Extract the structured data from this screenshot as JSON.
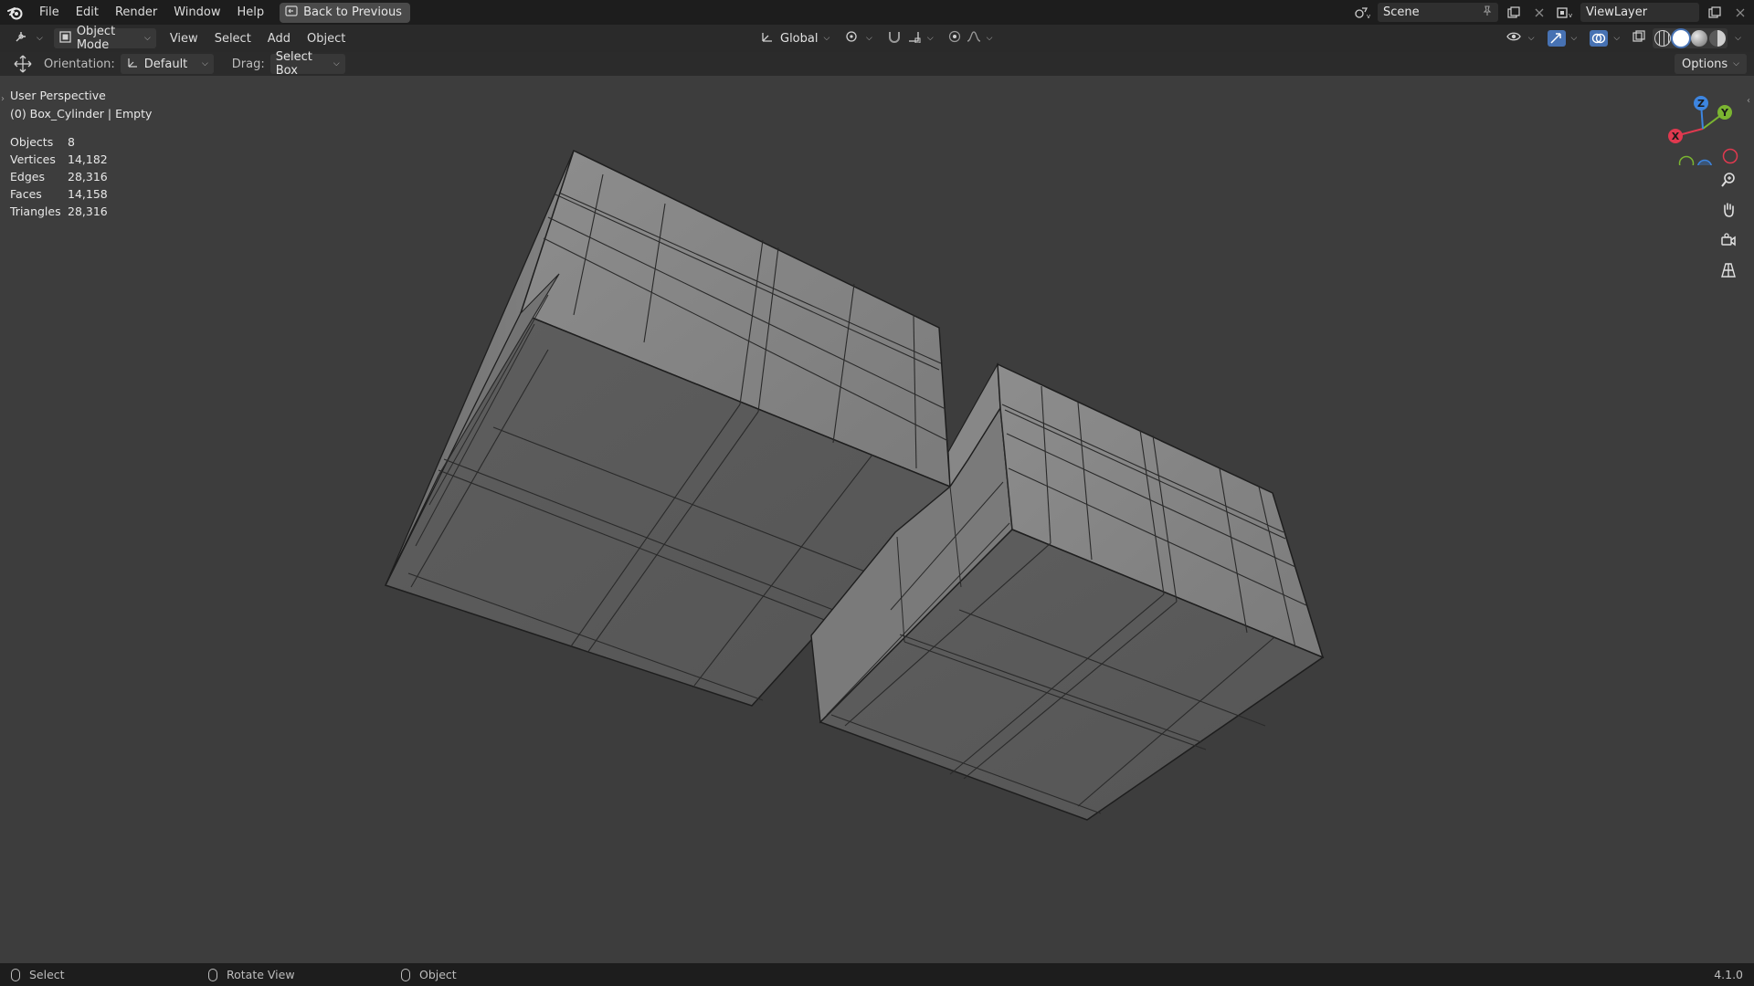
{
  "menu": {
    "items": [
      "File",
      "Edit",
      "Render",
      "Window",
      "Help"
    ],
    "back_label": "Back to Previous"
  },
  "top_right": {
    "scene": "Scene",
    "view_layer": "ViewLayer"
  },
  "header": {
    "mode": "Object Mode",
    "menus": [
      "View",
      "Select",
      "Add",
      "Object"
    ],
    "transform_orientation": "Global"
  },
  "tool_settings": {
    "orientation_label": "Orientation:",
    "orientation_value": "Default",
    "drag_label": "Drag:",
    "drag_value": "Select Box",
    "options_label": "Options"
  },
  "viewport": {
    "perspective": "User Perspective",
    "active_object": "(0) Box_Cylinder | Empty",
    "stats": [
      {
        "label": "Objects",
        "value": "8"
      },
      {
        "label": "Vertices",
        "value": "14,182"
      },
      {
        "label": "Edges",
        "value": "28,316"
      },
      {
        "label": "Faces",
        "value": "14,158"
      },
      {
        "label": "Triangles",
        "value": "28,316"
      }
    ],
    "gizmo": {
      "x": "X",
      "y": "Y",
      "z": "Z"
    }
  },
  "status": {
    "items": [
      "Select",
      "Rotate View",
      "Object"
    ],
    "version": "4.1.0"
  },
  "colors": {
    "axis_x": "#e0394f",
    "axis_y": "#7bb531",
    "axis_z": "#3d85e0"
  }
}
